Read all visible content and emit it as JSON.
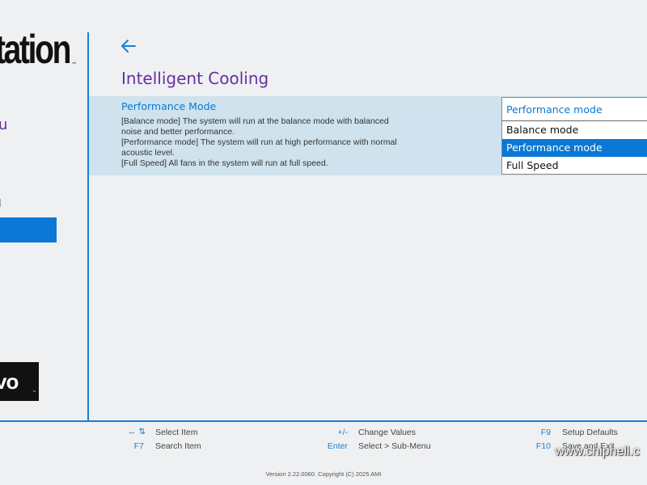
{
  "sidebar": {
    "brand_partial": "tation",
    "brand_tm": "™",
    "item_partial_1": "u",
    "item_partial_2": "l",
    "logo_partial": "vo",
    "logo_tm": "™"
  },
  "page": {
    "title": "Intelligent Cooling",
    "back_icon": "arrow-left-icon"
  },
  "setting": {
    "label": "Performance Mode",
    "description": [
      "[Balance mode] The system will run at the balance mode with balanced",
      "noise and better performance.",
      "[Performance mode] The system will run at high performance with normal",
      "acoustic level.",
      "[Full Speed] All fans in the system will run at full speed."
    ],
    "current_value": "Performance mode",
    "options": [
      "Balance mode",
      "Performance mode",
      "Full Speed"
    ],
    "selected_index": 1
  },
  "hotkeys": {
    "select_item": {
      "key": "↔ ⇅",
      "label": "Select Item"
    },
    "search_item": {
      "key": "F7",
      "label": "Search Item"
    },
    "change_values": {
      "key": "+/-",
      "label": "Change Values"
    },
    "sub_menu": {
      "key": "Enter",
      "label": "Select > Sub-Menu"
    },
    "setup_defaults": {
      "key": "F9",
      "label": "Setup Defaults"
    },
    "save_exit": {
      "key": "F10",
      "label": "Save and Exit"
    }
  },
  "footer": {
    "version": "Version 2.22.0060. Copyright (C) 2025 AMI"
  },
  "watermark": "www.chiphell.c",
  "colors": {
    "accent": "#0a78d4",
    "title": "#6a2fa3",
    "row_highlight": "#cfe2ee",
    "background": "#eef0f2"
  }
}
